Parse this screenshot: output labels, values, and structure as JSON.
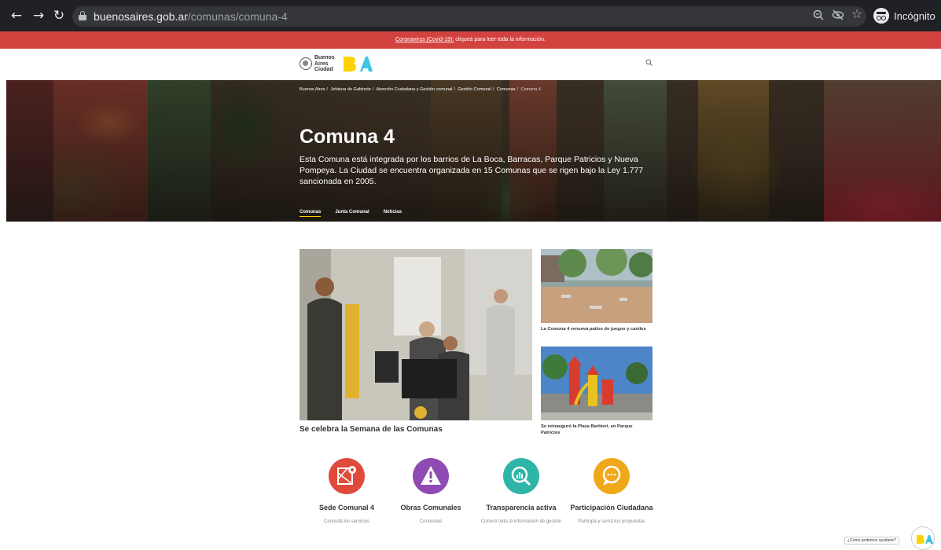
{
  "browser": {
    "url_host": "buenosaires.gob.ar",
    "url_path": "/comunas/comuna-4",
    "incognito_label": "Incógnito",
    "icons": [
      "back-arrow-icon",
      "forward-arrow-icon",
      "reload-icon",
      "lock-icon",
      "zoom-icon",
      "eye-off-icon",
      "star-icon",
      "incognito-icon"
    ]
  },
  "alert": {
    "link_text": "Coronavirus (Covid-19):",
    "text": " cliqueá para leer toda la información."
  },
  "header": {
    "logo_line1": "Buenos",
    "logo_line2": "Aires",
    "logo_line3": "Ciudad",
    "search_icon": "search-icon"
  },
  "hero": {
    "breadcrumb": [
      "Buenos Aires",
      "Jefatura de Gabinete",
      "Atención Ciudadana y Gestión comunal",
      "Gestión Comunal",
      "Comunas",
      "Comuna 4"
    ],
    "title": "Comuna 4",
    "description": "Esta Comuna está integrada por los barrios de La Boca, Barracas, Parque Patricios y Nueva Pompeya. La Ciudad se encuentra organizada en 15 Comunas que se rigen bajo la Ley 1.777 sancionada en 2005.",
    "tabs": [
      {
        "label": "Comunas"
      },
      {
        "label": "Junta Comunal"
      },
      {
        "label": "Noticias"
      }
    ]
  },
  "news": {
    "main_caption": "Se celebra la Semana de las Comunas",
    "side": [
      {
        "caption": "La Comuna 4 renueva patios de juegos y caniles"
      },
      {
        "caption": "Se reinauguró la Plaza Barbieri, en Parque Patricios"
      }
    ]
  },
  "shortcuts": [
    {
      "title": "Sede Comunal 4",
      "sub": "Consultá los servicios",
      "color": "#e04a3b",
      "icon": "map-pin-icon"
    },
    {
      "title": "Obras Comunales",
      "sub": "Conocelas",
      "color": "#8f4bb3",
      "icon": "warning-icon"
    },
    {
      "title": "Transparencia activa",
      "sub": "Conocé toda la información de gestión",
      "color": "#2fb4a8",
      "icon": "magnifier-chart-icon"
    },
    {
      "title": "Participación Ciudadana",
      "sub": "Participá y sumá tus propuestas",
      "color": "#f0a81b",
      "icon": "chat-bubble-icon"
    }
  ],
  "chat": {
    "label": "¿Cómo podemos ayudarte?"
  },
  "colors": {
    "chrome_bg": "#202124",
    "alert_bg": "#d2433f",
    "brand_yellow": "#fdd306",
    "brand_cyan": "#3bc4e4"
  }
}
